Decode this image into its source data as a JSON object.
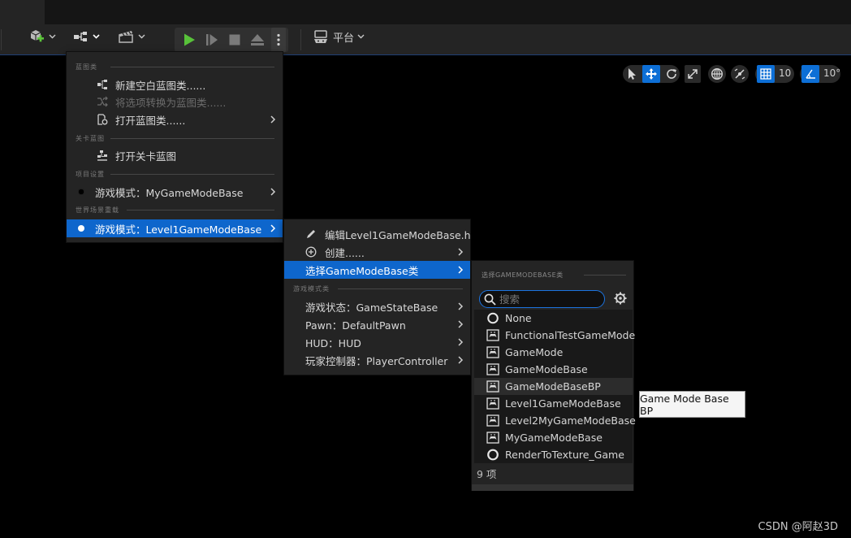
{
  "toolbar": {
    "platform_label": "平台",
    "colors": {
      "play_green": "#58c23a",
      "accent_blue": "#0e66cc"
    }
  },
  "viewport": {
    "grid_size": "10",
    "rotation_snap": "10°"
  },
  "blueprint_menu": {
    "sections": [
      "蓝图类",
      "关卡蓝图",
      "项目设置",
      "世界场景重载"
    ],
    "items": [
      {
        "label": "新建空白蓝图类......",
        "icon": "blueprint-class-icon"
      },
      {
        "label": "将选项转换为蓝图类......",
        "icon": "convert-icon",
        "disabled": true
      },
      {
        "label": "打开蓝图类......",
        "icon": "open-blueprint-icon"
      },
      {
        "label": "打开关卡蓝图",
        "icon": "level-blueprint-icon"
      },
      {
        "label": "游戏模式：MyGameModeBase",
        "icon": "bullet-icon"
      },
      {
        "label": "游戏模式：Level1GameModeBase",
        "icon": "bullet-icon",
        "highlighted": true
      }
    ]
  },
  "gamemode_submenu": {
    "section": "游戏模式类",
    "items": [
      {
        "label": "编辑Level1GameModeBase.h",
        "icon": "edit-icon"
      },
      {
        "label": "创建......",
        "icon": "add-circle-icon"
      },
      {
        "label": "选择GameModeBase类",
        "highlighted": true
      },
      {
        "label": "游戏状态：GameStateBase"
      },
      {
        "label": "Pawn：DefaultPawn"
      },
      {
        "label": "HUD：HUD"
      },
      {
        "label": "玩家控制器：PlayerController"
      }
    ]
  },
  "class_picker": {
    "header": "选择GAMEMODEBASE类",
    "search_placeholder": "搜索",
    "items": [
      {
        "label": "None",
        "icon": "none-circle-icon"
      },
      {
        "label": "FunctionalTestGameMode",
        "icon": "gamemode-class-icon"
      },
      {
        "label": "GameMode",
        "icon": "gamemode-class-icon"
      },
      {
        "label": "GameModeBase",
        "icon": "gamemode-class-icon"
      },
      {
        "label": "GameModeBaseBP",
        "icon": "gamemode-class-icon",
        "hovered": true
      },
      {
        "label": "Level1GameModeBase",
        "icon": "gamemode-class-icon"
      },
      {
        "label": "Level2MyGameModeBase",
        "icon": "gamemode-class-icon"
      },
      {
        "label": "MyGameModeBase",
        "icon": "gamemode-class-icon"
      },
      {
        "label": "RenderToTexture_Game",
        "icon": "circle-class-icon"
      }
    ],
    "count_label": "9 项"
  },
  "tooltip": {
    "text": "Game Mode Base BP"
  },
  "watermark": "CSDN @阿赵3D"
}
